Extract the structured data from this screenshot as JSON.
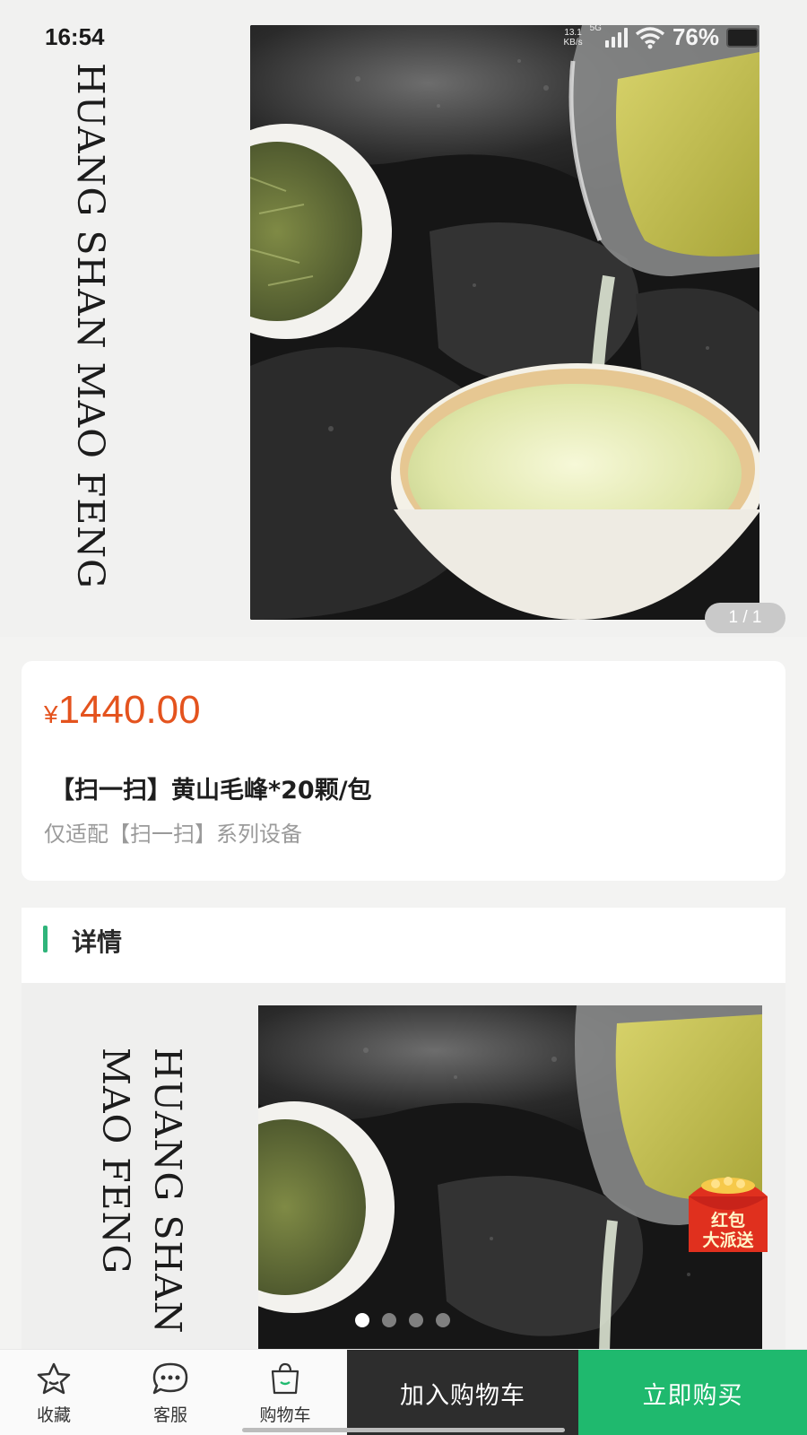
{
  "status_bar": {
    "time": "16:54",
    "network_speed": "13.1\nKB/s",
    "network_type": "5G",
    "battery": "76%",
    "icons": [
      "signal-icon",
      "wifi-icon",
      "battery-icon"
    ]
  },
  "hero": {
    "title": "HUANG SHAN MAO FENG",
    "page_indicator": "1 / 1"
  },
  "product": {
    "currency": "¥",
    "price": "1440.00",
    "title": "【扫一扫】黄山毛峰*20颗/包",
    "subtitle": "仅适配【扫一扫】系列设备"
  },
  "details": {
    "title": "详情",
    "banner_title": "HUANG SHAN MAO FENG",
    "carousel_dots": 4,
    "active_dot": 1
  },
  "promo": {
    "red_packet": "红包\n大派送"
  },
  "bottom_bar": {
    "favorite": "收藏",
    "service": "客服",
    "cart": "购物车",
    "add_to_cart": "加入购物车",
    "buy_now": "立即购买"
  },
  "colors": {
    "price": "#e4531e",
    "accent_green": "#1fb96e",
    "cart_button": "#2d2d2d"
  }
}
